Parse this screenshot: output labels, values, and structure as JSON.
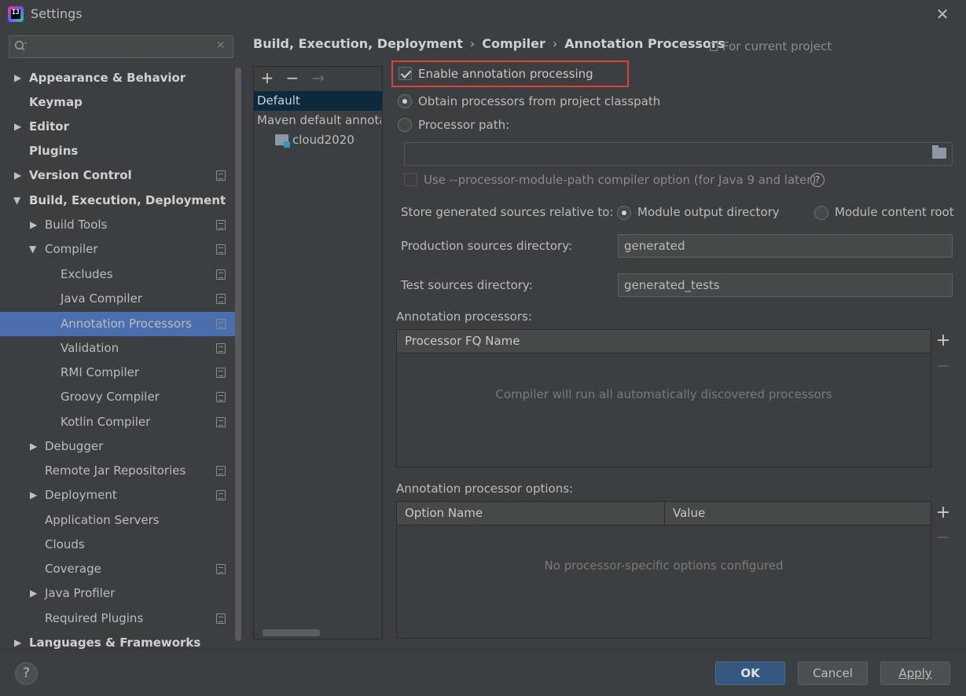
{
  "window": {
    "title": "Settings",
    "close_glyph": "✕",
    "logo_text": "IJ"
  },
  "search": {
    "placeholder": "",
    "clear_glyph": "✕"
  },
  "sidebar": {
    "items": [
      {
        "label": "Appearance & Behavior",
        "arrow": "▶"
      },
      {
        "label": "Keymap"
      },
      {
        "label": "Editor",
        "arrow": "▶"
      },
      {
        "label": "Plugins"
      },
      {
        "label": "Version Control",
        "arrow": "▶"
      },
      {
        "label": "Build, Execution, Deployment",
        "arrow": "▼"
      },
      {
        "label": "Build Tools",
        "arrow": "▶"
      },
      {
        "label": "Compiler",
        "arrow": "▼"
      },
      {
        "label": "Excludes"
      },
      {
        "label": "Java Compiler"
      },
      {
        "label": "Annotation Processors"
      },
      {
        "label": "Validation"
      },
      {
        "label": "RMI Compiler"
      },
      {
        "label": "Groovy Compiler"
      },
      {
        "label": "Kotlin Compiler"
      },
      {
        "label": "Debugger",
        "arrow": "▶"
      },
      {
        "label": "Remote Jar Repositories"
      },
      {
        "label": "Deployment",
        "arrow": "▶"
      },
      {
        "label": "Application Servers"
      },
      {
        "label": "Clouds"
      },
      {
        "label": "Coverage"
      },
      {
        "label": "Java Profiler",
        "arrow": "▶"
      },
      {
        "label": "Required Plugins"
      },
      {
        "label": "Languages & Frameworks",
        "arrow": "▶"
      }
    ]
  },
  "breadcrumb": {
    "parts": [
      "Build, Execution, Deployment",
      "Compiler",
      "Annotation Processors"
    ],
    "separator": "›"
  },
  "scope_label": "For current project",
  "profiles": {
    "toolbar": {
      "add": "+",
      "remove": "−",
      "move": "→"
    },
    "default_label": "Default",
    "maven_label": "Maven default annotation processors profile",
    "module_label": "cloud2020"
  },
  "options": {
    "enable_label": "Enable annotation processing",
    "enable_checked": true,
    "obtain_label": "Obtain processors from project classpath",
    "processor_path_label": "Processor path:",
    "processor_path_value": "",
    "module_path_label": "Use --processor-module-path compiler option (for Java 9 and later)",
    "help_glyph": "?",
    "store_label": "Store generated sources relative to:",
    "store_output_label": "Module output directory",
    "store_content_label": "Module content root",
    "production_label": "Production sources directory:",
    "production_value": "generated",
    "test_label": "Test sources directory:",
    "test_value": "generated_tests"
  },
  "processors_table": {
    "title": "Annotation processors:",
    "column": "Processor FQ Name",
    "empty_text": "Compiler will run all automatically discovered processors",
    "add": "+",
    "remove": "−"
  },
  "options_table": {
    "title": "Annotation processor options:",
    "columns": [
      "Option Name",
      "Value"
    ],
    "empty_text": "No processor-specific options configured",
    "add": "+",
    "remove": "−"
  },
  "footer": {
    "help": "?",
    "ok": "OK",
    "cancel": "Cancel",
    "apply": "Apply"
  },
  "colors": {
    "accent_selection": "#4b6eaf",
    "highlight_box": "#e0413c",
    "primary_button": "#365880"
  }
}
